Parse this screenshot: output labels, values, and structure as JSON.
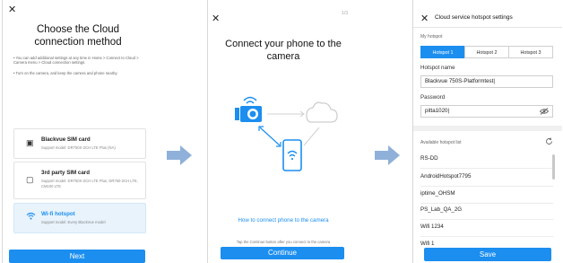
{
  "panel1": {
    "close_glyph": "✕",
    "title": "Choose the Cloud connection method",
    "note_1": "• You can add additional settings at any time in Home > Connect to Cloud > Camera menu > Cloud connection settings.",
    "note_2": "• Turn on the camera, and keep the camera and phone nearby",
    "cards": [
      {
        "icon": "sim-card-icon",
        "title": "Blackvue SIM card",
        "subtitle": "Support model: DR750X-2CH LTE Plus (NA)"
      },
      {
        "icon": "sim-card-icon",
        "title": "3rd party SIM card",
        "subtitle": "Support model: DR750X-2CH LTE Plus, DR750-2CH LTE, CM100 LTE"
      },
      {
        "icon": "wifi-icon",
        "title": "Wi-fi hotspot",
        "subtitle": "Support model: Every BlackVue model"
      }
    ],
    "next_label": "Next"
  },
  "panel2": {
    "close_glyph": "✕",
    "page_indicator": "1/3",
    "title": "Connect your phone to the camera",
    "link_text": "How to connect phone to the camera",
    "tap_text": "Tap the Continue button after you connect to the camera",
    "continue_label": "Continue"
  },
  "panel3": {
    "close_glyph": "✕",
    "header": "Cloud service hotspot settings",
    "my_hotspot_label": "My hotspot",
    "tabs": [
      "Hotspot 1",
      "Hotspot 2",
      "Hotspot 3"
    ],
    "selected_tab": "Hotspot 1",
    "hotspot_name_label": "Hotspot name",
    "hotspot_name_value": "Blackvue 750S-Platformtest|",
    "password_label": "Password",
    "password_value": "pitta1020|",
    "available_label": "Available hotspot list",
    "hotspots": [
      "RS-DD",
      "AndroidHotspot7795",
      "iptime_OHSM",
      "PS_Lab_QA_2G",
      "Wifi 1234",
      "Wifi 1"
    ],
    "save_label": "Save"
  },
  "colors": {
    "accent": "#1b8ef0",
    "arrow": "#8fb0d9",
    "selected_card_bg": "#e8f3fc"
  }
}
